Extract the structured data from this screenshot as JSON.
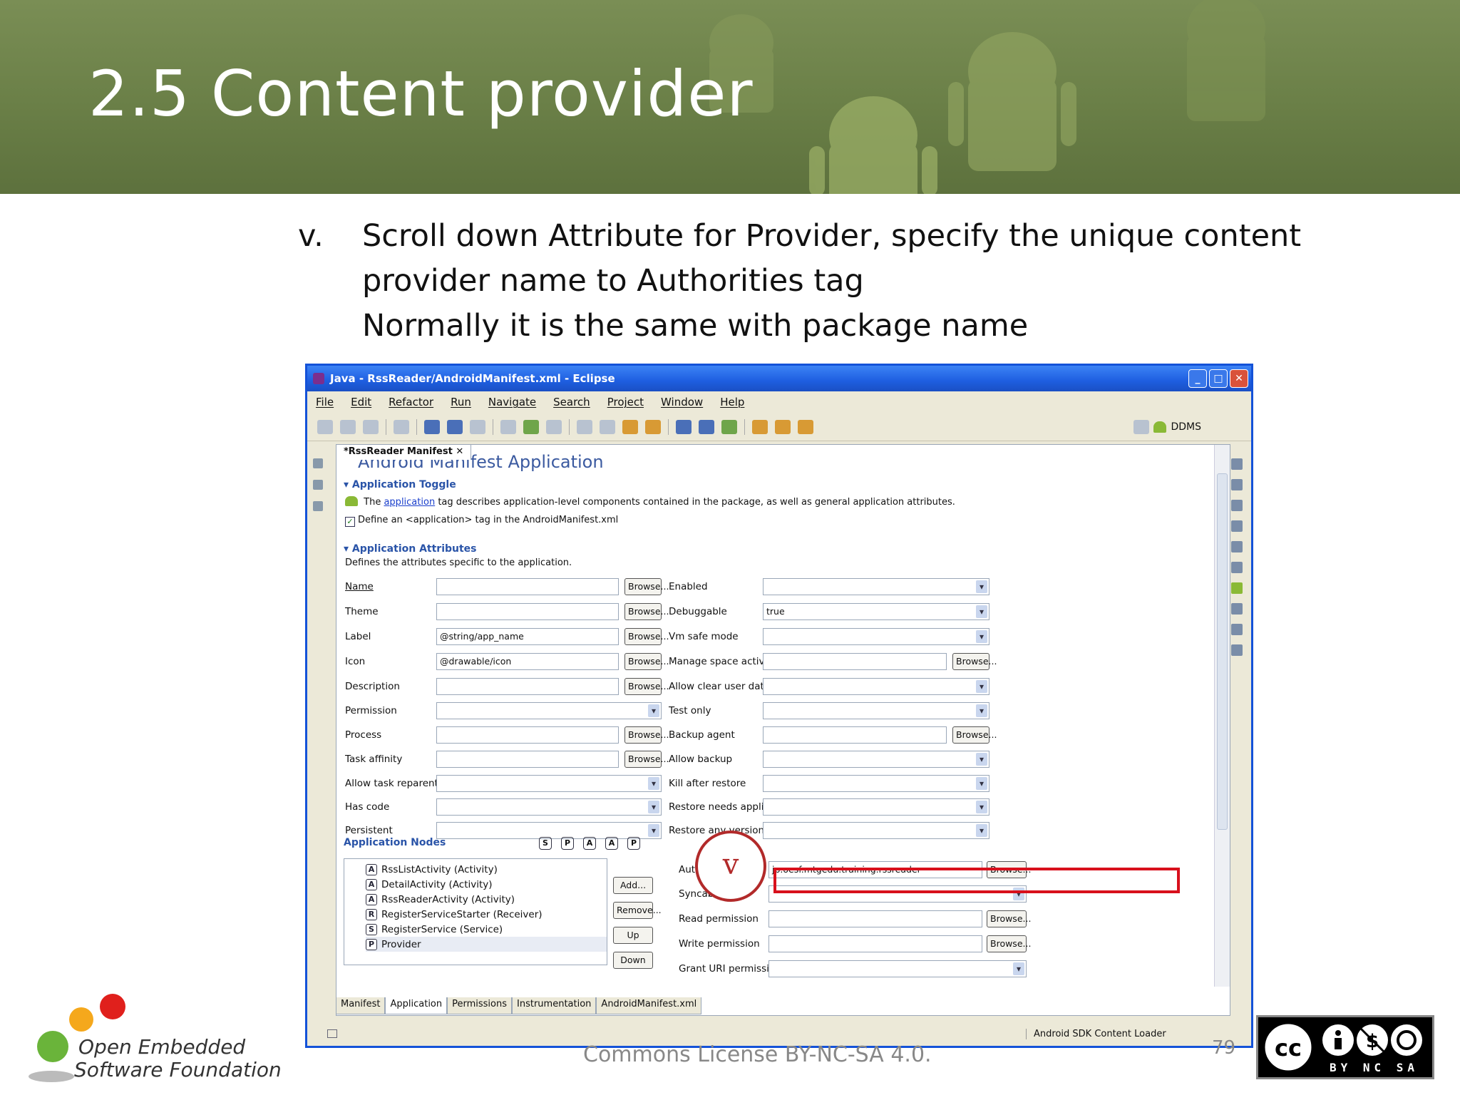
{
  "slide": {
    "title": "2.5 Content provider",
    "bullet_marker": "v.",
    "bullet_lines": [
      "Scroll down Attribute for Provider, specify the unique content",
      "provider name to Authorities tag",
      "Normally it is the same with package name"
    ],
    "footer_text": "Commons License BY-NC-SA 4.0.",
    "page_number": "79",
    "org_name_line1": "Open Embedded",
    "org_name_line2": "Software Foundation",
    "license_labels": "BY NC SA",
    "callout_label": "v"
  },
  "eclipse": {
    "window_title": "Java - RssReader/AndroidManifest.xml - Eclipse",
    "menu": [
      "File",
      "Edit",
      "Refactor",
      "Run",
      "Navigate",
      "Search",
      "Project",
      "Window",
      "Help"
    ],
    "perspective_label": "DDMS",
    "editor_tab": "*RssReader Manifest",
    "heading": "Android Manifest Application",
    "toggle_section": "Application Toggle",
    "toggle_desc_pre": "The",
    "toggle_desc_link": "application",
    "toggle_desc_post": "tag describes application-level components contained in the package, as well as general application attributes.",
    "define_checkbox": "Define an <application> tag in the AndroidManifest.xml",
    "attrs_section": "Application Attributes",
    "attrs_desc": "Defines the attributes specific to the application.",
    "browse_label": "Browse...",
    "left_attrs": [
      {
        "label": "Name",
        "value": ""
      },
      {
        "label": "Theme",
        "value": ""
      },
      {
        "label": "Label",
        "value": "@string/app_name"
      },
      {
        "label": "Icon",
        "value": "@drawable/icon"
      },
      {
        "label": "Description",
        "value": ""
      },
      {
        "label": "Permission",
        "value": ""
      },
      {
        "label": "Process",
        "value": ""
      },
      {
        "label": "Task affinity",
        "value": ""
      },
      {
        "label": "Allow task reparenting",
        "value": ""
      },
      {
        "label": "Has code",
        "value": ""
      },
      {
        "label": "Persistent",
        "value": ""
      }
    ],
    "right_attrs": [
      {
        "label": "Enabled",
        "value": ""
      },
      {
        "label": "Debuggable",
        "value": "true"
      },
      {
        "label": "Vm safe mode",
        "value": ""
      },
      {
        "label": "Manage space activity",
        "value": ""
      },
      {
        "label": "Allow clear user data",
        "value": ""
      },
      {
        "label": "Test only",
        "value": ""
      },
      {
        "label": "Backup agent",
        "value": ""
      },
      {
        "label": "Allow backup",
        "value": ""
      },
      {
        "label": "Kill after restore",
        "value": ""
      },
      {
        "label": "Restore needs application",
        "value": ""
      },
      {
        "label": "Restore any version",
        "value": ""
      }
    ],
    "nodes_section": "Application Nodes",
    "node_filter_icons": [
      "S",
      "P",
      "A",
      "A",
      "P"
    ],
    "nodes": [
      {
        "badge": "A",
        "label": "RssListActivity (Activity)"
      },
      {
        "badge": "A",
        "label": "DetailActivity (Activity)"
      },
      {
        "badge": "A",
        "label": "RssReaderActivity (Activity)"
      },
      {
        "badge": "R",
        "label": "RegisterServiceStarter (Receiver)"
      },
      {
        "badge": "S",
        "label": "RegisterService (Service)"
      },
      {
        "badge": "P",
        "label": "Provider"
      }
    ],
    "node_buttons": [
      "Add...",
      "Remove...",
      "Up",
      "Down"
    ],
    "provider_attrs": [
      {
        "label": "Authorities*",
        "value": "jp.oesf.mtgedu.training.rssreader"
      },
      {
        "label": "Syncable",
        "value": ""
      },
      {
        "label": "Read permission",
        "value": ""
      },
      {
        "label": "Write permission",
        "value": ""
      },
      {
        "label": "Grant URI permissions",
        "value": ""
      }
    ],
    "bottom_tabs": [
      "Manifest",
      "Application",
      "Permissions",
      "Instrumentation",
      "AndroidManifest.xml"
    ],
    "status_text": "Android SDK Content Loader"
  }
}
